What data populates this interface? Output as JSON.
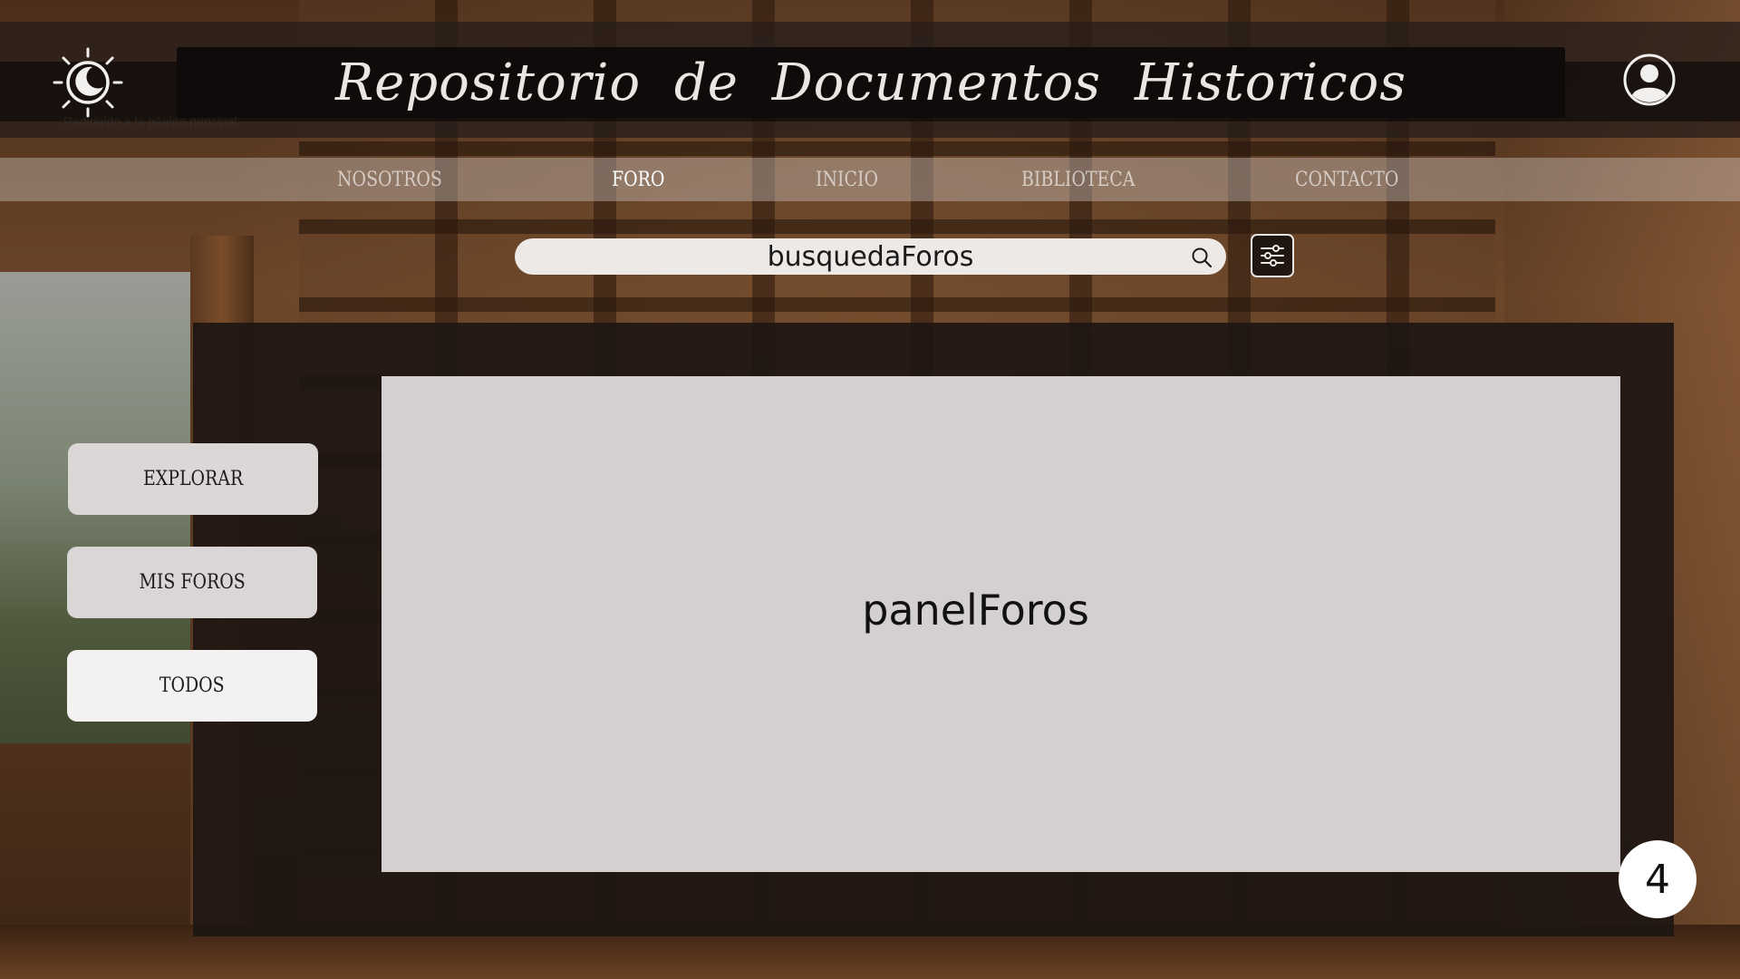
{
  "header": {
    "title": "Repositorio  de  Documentos  Historicos",
    "home_hint": "Redirigido a la página principal",
    "theme_toggle_icon": "sun-moon-icon",
    "profile_icon": "user-profile-icon"
  },
  "nav": {
    "items": [
      {
        "label": "NOSOTROS",
        "active": false
      },
      {
        "label": "FORO",
        "active": true
      },
      {
        "label": "INICIO",
        "active": false
      },
      {
        "label": "BIBLIOTECA",
        "active": false
      },
      {
        "label": "CONTACTO",
        "active": false
      }
    ]
  },
  "search": {
    "placeholder": "busquedaForos",
    "search_icon": "search-icon",
    "filter_icon": "sliders-icon"
  },
  "sidebar": {
    "buttons": [
      {
        "label": "EXPLORAR"
      },
      {
        "label": "MIS FOROS"
      },
      {
        "label": "TODOS"
      }
    ]
  },
  "main": {
    "panel_label": "panelForos"
  },
  "page_badge": "4",
  "colors": {
    "title_bar": "#0f0b0a",
    "panel": "#d3d0cf",
    "card": "#1e1612",
    "nav_active": "#ffffff"
  }
}
